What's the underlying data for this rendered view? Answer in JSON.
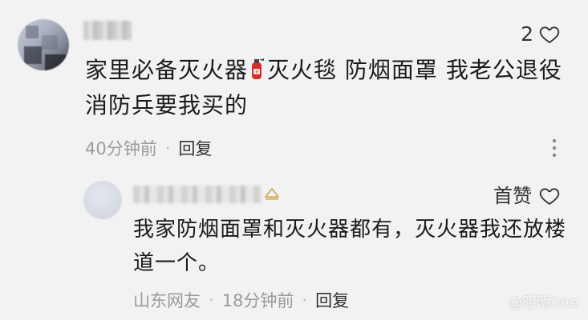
{
  "main_comment": {
    "likes": "2",
    "text": "家里必备灭火器🧯灭火毯 防烟面罩 我老公退役消防兵要我买的",
    "text_part1": "家里必备灭火器",
    "text_part2": "灭火毯 防烟面罩 我老公退役消防兵要我买的",
    "time": "40分钟前",
    "separator": "·",
    "reply_label": "回复"
  },
  "reply_comment": {
    "first_like_label": "首赞",
    "text": "我家防烟面罩和灭火器都有，灭火器我还放楼道一个。",
    "location": "山东网友",
    "separator": "·",
    "time": "18分钟前",
    "reply_label": "回复"
  },
  "watermark": "@昭昭0ne",
  "icons": {
    "like": "heart-outline-icon",
    "more": "vertical-ellipsis-icon",
    "emoji": "fire-extinguisher-icon",
    "badge": "user-badge-icon"
  },
  "colors": {
    "background": "#f2f2f2",
    "text_primary": "#1a1a1a",
    "text_meta": "#9a9a9a",
    "extinguisher": "#d32f2f"
  }
}
